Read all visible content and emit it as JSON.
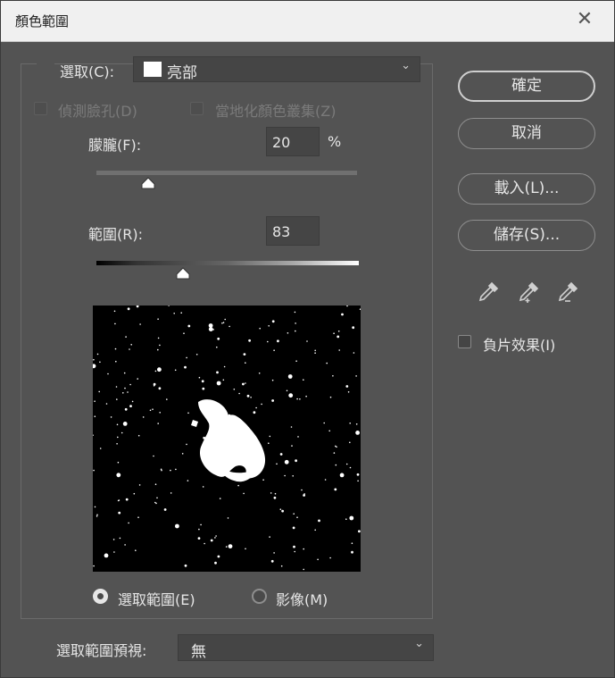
{
  "window": {
    "title": "顏色範圍",
    "close_glyph": "✕"
  },
  "select": {
    "label": "選取(C):",
    "value": "亮部",
    "swatch_color": "#ffffff"
  },
  "options": {
    "detect_faces": {
      "label": "偵測臉孔(D)",
      "checked": false,
      "enabled": false
    },
    "localized_clusters": {
      "label": "當地化顏色叢集(Z)",
      "checked": false,
      "enabled": false
    }
  },
  "fuzziness": {
    "label": "朦朧(F):",
    "value": "20",
    "unit": "%",
    "slider_fraction": 0.2
  },
  "range": {
    "label": "範圍(R):",
    "value": "83",
    "slider_fraction": 0.33
  },
  "preview_mode": {
    "selection": {
      "label": "選取範圍(E)",
      "checked": true
    },
    "image": {
      "label": "影像(M)",
      "checked": false
    }
  },
  "selection_preview": {
    "label": "選取範圍預視:",
    "value": "無"
  },
  "buttons": {
    "ok": "確定",
    "cancel": "取消",
    "load": "載入(L)...",
    "save": "儲存(S)..."
  },
  "eyedroppers": [
    "eyedropper-icon",
    "eyedropper-plus-icon",
    "eyedropper-minus-icon"
  ],
  "invert": {
    "label": "負片效果(I)",
    "checked": false
  }
}
